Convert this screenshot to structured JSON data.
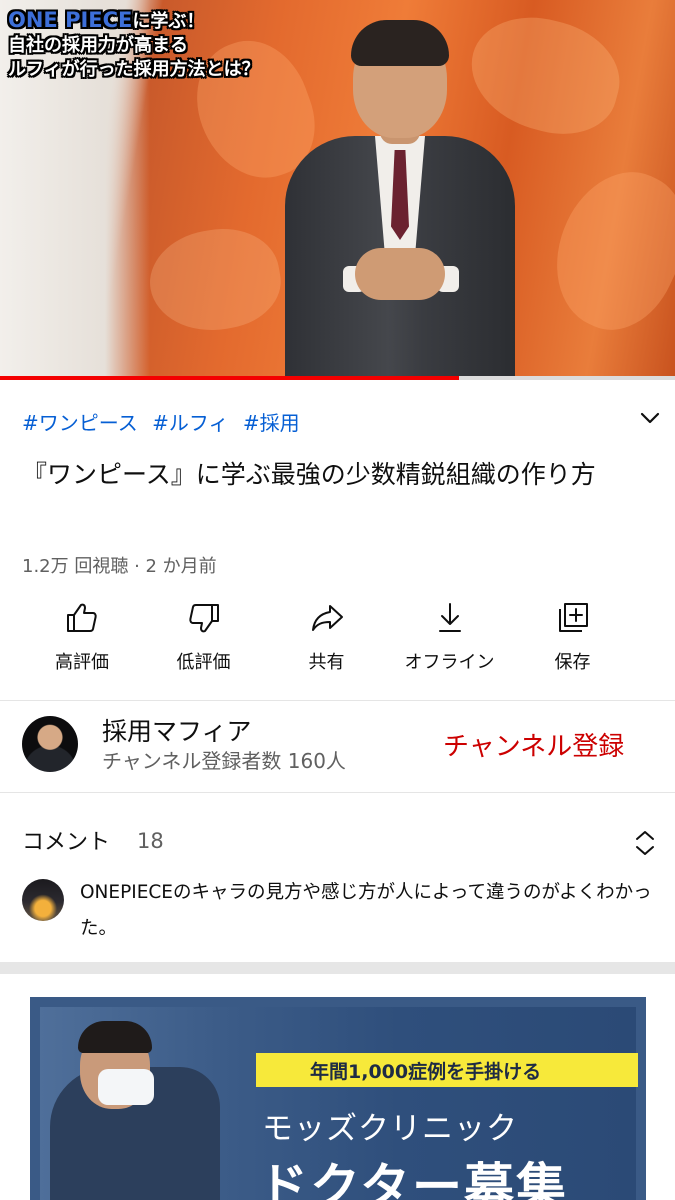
{
  "video": {
    "overlay_brand": "ONE PIECE",
    "overlay_line1": "に学ぶ！",
    "overlay_line2": "自社の採用力が高まる",
    "overlay_line3": "ルフィが行った採用方法とは？",
    "progress_fraction": 0.68,
    "progress_color": "#f40000"
  },
  "hashtags": [
    "#ワンピース",
    "#ルフィ",
    "#採用"
  ],
  "title": "『ワンピース』に学ぶ最強の少数精鋭組織の作り方",
  "meta": "1.2万 回視聴 · 2 か月前",
  "actions": [
    {
      "label": "高評価",
      "icon": "thumbs-up-icon"
    },
    {
      "label": "低評価",
      "icon": "thumbs-down-icon"
    },
    {
      "label": "共有",
      "icon": "share-icon"
    },
    {
      "label": "オフライン",
      "icon": "download-icon"
    },
    {
      "label": "保存",
      "icon": "save-to-playlist-icon"
    }
  ],
  "channel": {
    "name": "採用マフィア",
    "subscribers": "チャンネル登録者数 160人",
    "subscribe_label": "チャンネル登録",
    "subscribe_color": "#cc0000"
  },
  "comments": {
    "header": "コメント",
    "count": "18",
    "top_comment": "ONEPIECEのキャラの見方や感じ方が人によって違うのがよくわかった。"
  },
  "ad": {
    "ribbon_text": "年間1,000症例を手掛ける",
    "clinic_name": "モッズクリニック",
    "headline": "ドクター募集"
  },
  "colors": {
    "link": "#065fd4",
    "secondary_text": "#606060",
    "ad_ribbon": "#f7e93a"
  }
}
